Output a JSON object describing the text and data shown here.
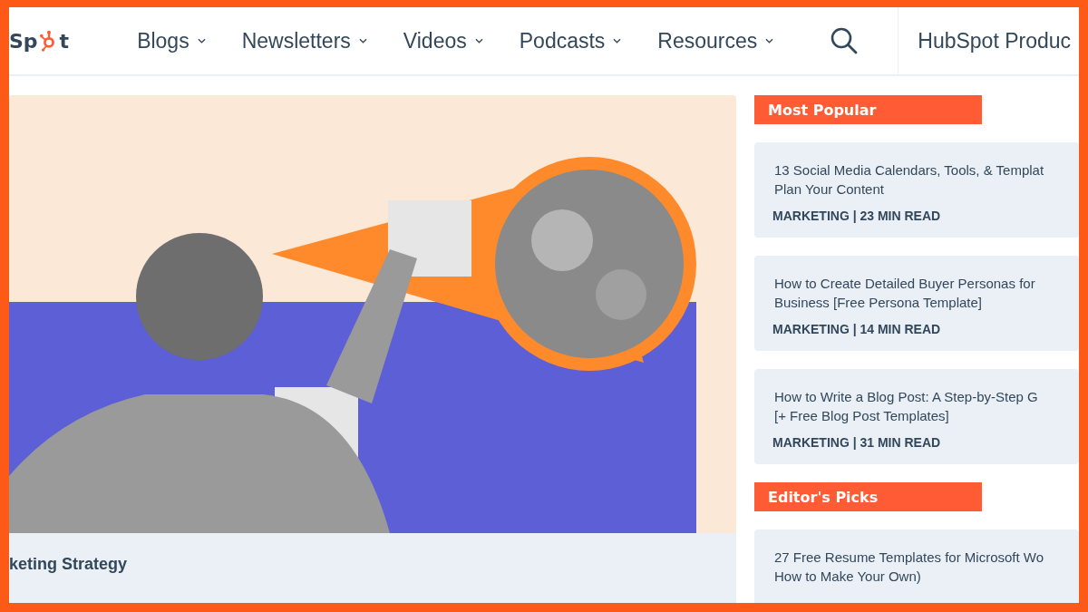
{
  "header": {
    "logo": {
      "before": "Sp",
      "after": "t"
    },
    "nav": [
      {
        "label": "Blogs"
      },
      {
        "label": "Newsletters"
      },
      {
        "label": "Videos"
      },
      {
        "label": "Podcasts"
      },
      {
        "label": "Resources"
      }
    ],
    "products_link": "HubSpot Produc"
  },
  "featured": {
    "title": "keting Strategy"
  },
  "sections": [
    {
      "heading": "Most Popular",
      "articles": [
        {
          "title": [
            "13 Social Media Calendars, Tools, & Templat",
            "Plan Your Content"
          ],
          "meta": "MARKETING | 23 MIN READ"
        },
        {
          "title": [
            "How to Create Detailed Buyer Personas for",
            "Business [Free Persona Template]"
          ],
          "meta": "MARKETING | 14 MIN READ"
        },
        {
          "title": [
            "How to Write a Blog Post: A Step-by-Step G",
            "[+ Free Blog Post Templates]"
          ],
          "meta": "MARKETING | 31 MIN READ"
        }
      ]
    },
    {
      "heading": "Editor's Picks",
      "articles": [
        {
          "title": [
            "27 Free Resume Templates for Microsoft Wo",
            "How to Make Your Own)"
          ]
        }
      ]
    }
  ]
}
